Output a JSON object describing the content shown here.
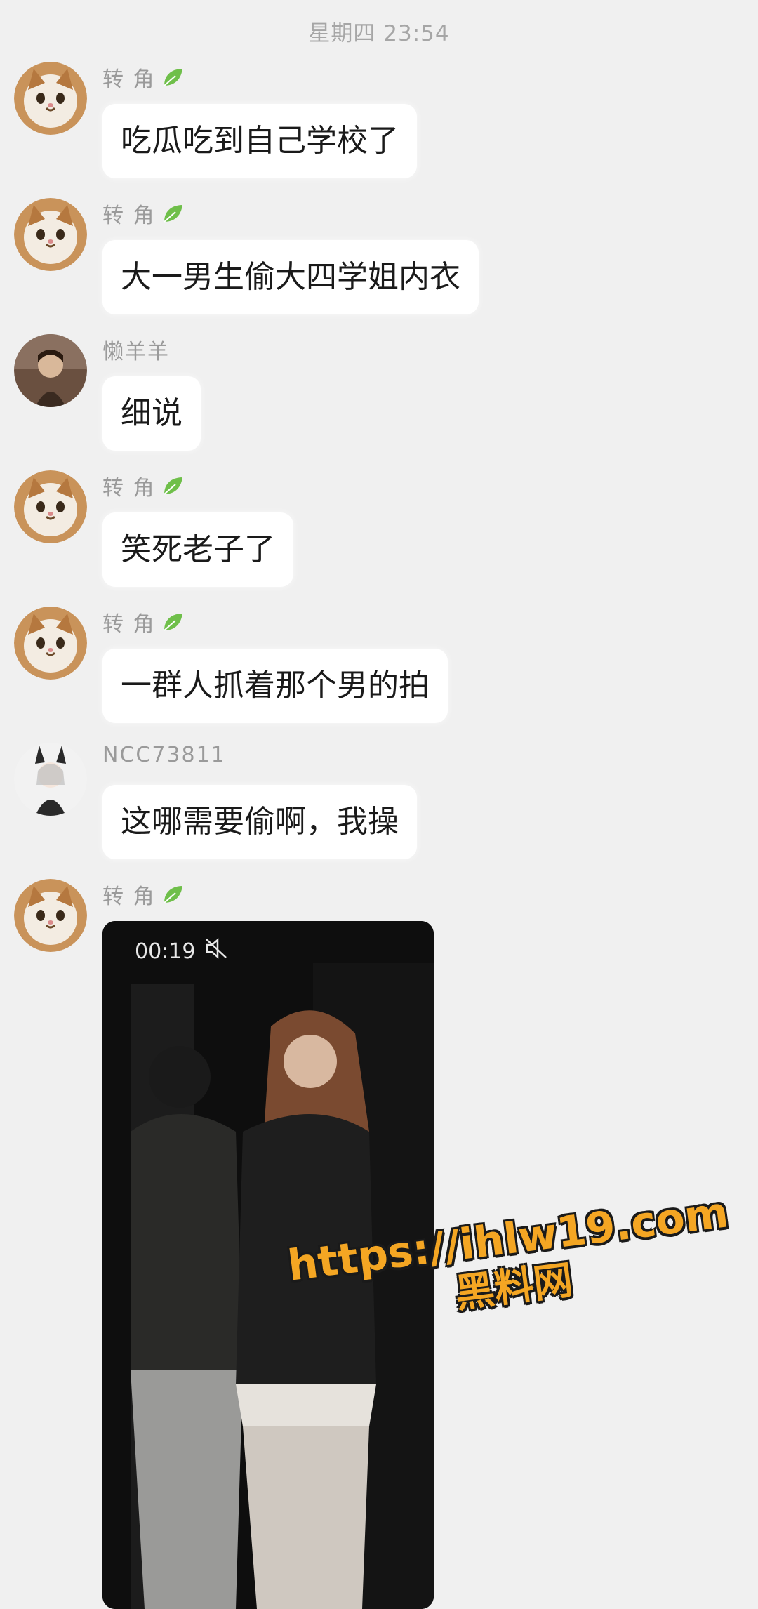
{
  "header": {
    "timestamp": "星期四 23:54"
  },
  "messages": [
    {
      "sender": "转 角",
      "leaf_badge": true,
      "text": "吃瓜吃到自己学校了",
      "avatar": "cat-avatar"
    },
    {
      "sender": "转 角",
      "leaf_badge": true,
      "text": "大一男生偷大四学姐内衣",
      "avatar": "cat-avatar"
    },
    {
      "sender": "懒羊羊",
      "leaf_badge": false,
      "text": "细说",
      "avatar": "person-avatar"
    },
    {
      "sender": "转 角",
      "leaf_badge": true,
      "text": "笑死老子了",
      "avatar": "cat-avatar"
    },
    {
      "sender": "转 角",
      "leaf_badge": true,
      "text": "一群人抓着那个男的拍",
      "avatar": "cat-avatar"
    },
    {
      "sender": "NCC73811",
      "leaf_badge": false,
      "text": "这哪需要偷啊，我操",
      "avatar": "anime-avatar"
    },
    {
      "sender": "转 角",
      "leaf_badge": true,
      "type": "video",
      "avatar": "cat-avatar"
    }
  ],
  "video": {
    "duration": "00:19",
    "muted_icon": "muted-speaker-icon"
  },
  "watermark": {
    "url": "https://ihlw19.com",
    "name": "黑料网"
  },
  "colors": {
    "background": "#f0f0f0",
    "bubble": "#ffffff",
    "nickname": "#9a9a9a",
    "watermark": "#f4a623"
  }
}
